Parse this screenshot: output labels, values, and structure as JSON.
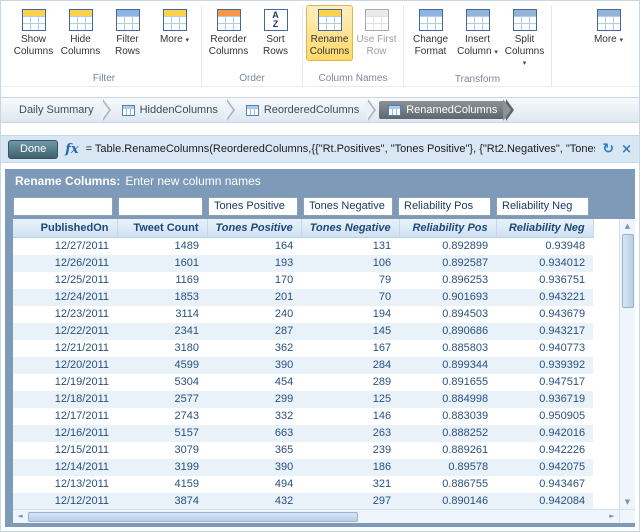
{
  "colors": {
    "panel_bg": "#7d9bb9",
    "active_button_bg": "#ffd968",
    "header_text": "#1d4876",
    "row_alt": "#e9f1f9",
    "formula_bar_bg": "#d9e7f4",
    "accent_blue": "#2f7bc4"
  },
  "icons": {
    "dropdown_arrow": "▾",
    "refresh": "↻",
    "close": "×",
    "scroll_up": "▲",
    "scroll_down": "▼",
    "scroll_left": "◄",
    "scroll_right": "►",
    "sort_letter_top": "A",
    "sort_letter_bottom": "Z"
  },
  "ribbon": {
    "groups": [
      {
        "label": "Filter",
        "buttons": [
          {
            "label": "Show Columns",
            "accent": "#ffd24d"
          },
          {
            "label": "Hide Columns",
            "accent": "#ffd24d"
          },
          {
            "label": "Filter Rows",
            "accent": "#8db3e2"
          },
          {
            "label": "More",
            "accent": "#ffd24d",
            "dropdown": true
          }
        ]
      },
      {
        "label": "Order",
        "buttons": [
          {
            "label": "Reorder Columns",
            "accent": "#f79646"
          },
          {
            "label": "Sort Rows",
            "accent": "#ffd24d"
          }
        ]
      },
      {
        "label": "Column Names",
        "buttons": [
          {
            "label": "Rename Columns",
            "accent": "#ffd24d",
            "state": "active"
          },
          {
            "label": "Use First Row",
            "accent": "#d9d9d9",
            "state": "disabled"
          }
        ]
      },
      {
        "label": "Transform",
        "buttons": [
          {
            "label": "Change Format",
            "accent": "#8db3e2"
          },
          {
            "label": "Insert Column",
            "accent": "#95b3d7",
            "dropdown": true
          },
          {
            "label": "Split Columns",
            "accent": "#95b3d7",
            "dropdown": true
          }
        ]
      },
      {
        "label": "",
        "buttons": [
          {
            "label": "More",
            "accent": "#95b3d7",
            "dropdown": true
          }
        ]
      }
    ]
  },
  "breadcrumb": {
    "items": [
      {
        "label": "Daily Summary"
      },
      {
        "label": "HiddenColumns"
      },
      {
        "label": "ReorderedColumns"
      },
      {
        "label": "RenamedColumns",
        "active": true
      }
    ]
  },
  "formula_bar": {
    "done_label": "Done",
    "fx_label": "fx",
    "formula": "= Table.RenameColumns(ReorderedColumns,{{\"Rt.Positives\", \"Tones Positive\"}, {\"Rt2.Negatives\", \"Tones"
  },
  "rename_panel": {
    "title": "Rename Columns:",
    "subtitle": "Enter new column names",
    "inputs": [
      "",
      "",
      "Tones Positive",
      "Tones Negative",
      "Reliability Pos",
      "Reliability Neg"
    ]
  },
  "table": {
    "headers": [
      {
        "label": "PublishedOn",
        "renamed": false
      },
      {
        "label": "Tweet Count",
        "renamed": false
      },
      {
        "label": "Tones Positive",
        "renamed": true
      },
      {
        "label": "Tones Negative",
        "renamed": true
      },
      {
        "label": "Reliability Pos",
        "renamed": true
      },
      {
        "label": "Reliability Neg",
        "renamed": true
      }
    ],
    "rows": [
      [
        "12/27/2011",
        "1489",
        "164",
        "131",
        "0.892899",
        "0.93948"
      ],
      [
        "12/26/2011",
        "1601",
        "193",
        "106",
        "0.892587",
        "0.934012"
      ],
      [
        "12/25/2011",
        "1169",
        "170",
        "79",
        "0.896253",
        "0.936751"
      ],
      [
        "12/24/2011",
        "1853",
        "201",
        "70",
        "0.901693",
        "0.943221"
      ],
      [
        "12/23/2011",
        "3114",
        "240",
        "194",
        "0.894503",
        "0.943679"
      ],
      [
        "12/22/2011",
        "2341",
        "287",
        "145",
        "0.890686",
        "0.943217"
      ],
      [
        "12/21/2011",
        "3180",
        "362",
        "167",
        "0.885803",
        "0.940773"
      ],
      [
        "12/20/2011",
        "4599",
        "390",
        "284",
        "0.899344",
        "0.939392"
      ],
      [
        "12/19/2011",
        "5304",
        "454",
        "289",
        "0.891655",
        "0.947517"
      ],
      [
        "12/18/2011",
        "2577",
        "299",
        "125",
        "0.884998",
        "0.936719"
      ],
      [
        "12/17/2011",
        "2743",
        "332",
        "146",
        "0.883039",
        "0.950905"
      ],
      [
        "12/16/2011",
        "5157",
        "663",
        "263",
        "0.888252",
        "0.942016"
      ],
      [
        "12/15/2011",
        "3079",
        "365",
        "239",
        "0.889261",
        "0.942226"
      ],
      [
        "12/14/2011",
        "3199",
        "390",
        "186",
        "0.89578",
        "0.942075"
      ],
      [
        "12/13/2011",
        "4159",
        "494",
        "321",
        "0.886755",
        "0.943467"
      ],
      [
        "12/12/2011",
        "3874",
        "432",
        "297",
        "0.890146",
        "0.942084"
      ]
    ]
  }
}
